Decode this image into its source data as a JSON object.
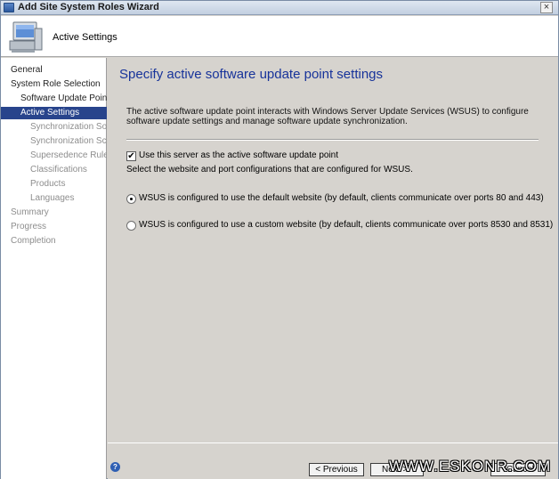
{
  "window": {
    "title": "Add Site System Roles Wizard",
    "close_glyph": "×"
  },
  "header": {
    "step_title": "Active Settings"
  },
  "sidebar": {
    "items": [
      {
        "label": "General",
        "state": "done",
        "indent": 0
      },
      {
        "label": "System Role Selection",
        "state": "done",
        "indent": 0
      },
      {
        "label": "Software Update Point",
        "state": "done",
        "indent": 1
      },
      {
        "label": "Active Settings",
        "state": "active",
        "indent": 1
      },
      {
        "label": "Synchronization Source",
        "state": "pending",
        "indent": 2
      },
      {
        "label": "Synchronization Schedule",
        "state": "pending",
        "indent": 2
      },
      {
        "label": "Supersedence Rules",
        "state": "pending",
        "indent": 2
      },
      {
        "label": "Classifications",
        "state": "pending",
        "indent": 2
      },
      {
        "label": "Products",
        "state": "pending",
        "indent": 2
      },
      {
        "label": "Languages",
        "state": "pending",
        "indent": 2
      },
      {
        "label": "Summary",
        "state": "pending",
        "indent": 0
      },
      {
        "label": "Progress",
        "state": "pending",
        "indent": 0
      },
      {
        "label": "Completion",
        "state": "pending",
        "indent": 0
      }
    ]
  },
  "main": {
    "section_title": "Specify active software update point settings",
    "description": "The active software update point interacts with Windows Server Update Services (WSUS) to configure software update settings and manage software update synchronization.",
    "checkbox": {
      "label": "Use this server as the active software update point",
      "checked": true,
      "glyph": "✔"
    },
    "info_text": "Select the website and port configurations that are configured for WSUS.",
    "radios": [
      {
        "label": "WSUS is configured to use the default website (by default, clients communicate over ports 80 and 443)",
        "selected": true
      },
      {
        "label": "WSUS is configured to use a custom website (by default, clients communicate over ports 8530 and 8531)",
        "selected": false
      }
    ]
  },
  "footer": {
    "help_glyph": "?",
    "prev_label": "< Previous",
    "next_label": "Next >",
    "cancel_label": "Cancel"
  },
  "watermark": "WWW.ESKONR.COM",
  "colors": {
    "accent": "#17339a",
    "active_nav": "#28448c",
    "pending_text": "#8d8d8d",
    "panel": "#d6d3ce"
  }
}
